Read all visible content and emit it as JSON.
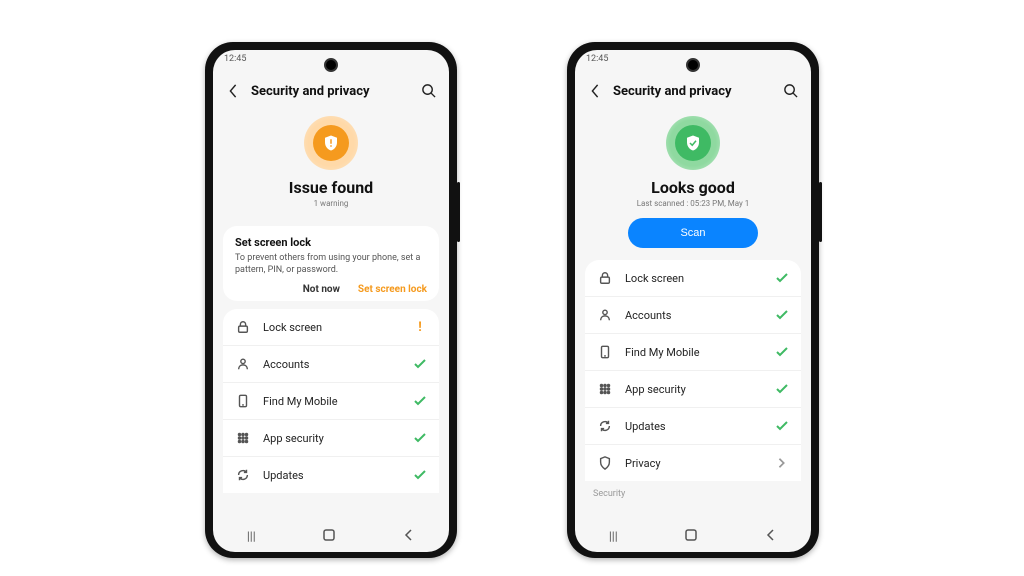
{
  "time": "12:45",
  "header_title": "Security and privacy",
  "left": {
    "status": "warn",
    "heading": "Issue found",
    "sub": "1 warning",
    "card": {
      "title": "Set screen lock",
      "desc": "To prevent others from using your phone, set a pattern, PIN, or password.",
      "ignore": "Not now",
      "primary": "Set screen lock"
    },
    "rows": [
      {
        "icon": "lock",
        "label": "Lock screen",
        "status": "alert"
      },
      {
        "icon": "user",
        "label": "Accounts",
        "status": "ok"
      },
      {
        "icon": "device",
        "label": "Find My Mobile",
        "status": "ok"
      },
      {
        "icon": "grid",
        "label": "App security",
        "status": "ok"
      },
      {
        "icon": "update",
        "label": "Updates",
        "status": "ok"
      }
    ]
  },
  "right": {
    "status": "ok",
    "heading": "Looks good",
    "sub": "Last scanned : 05:23 PM, May 1",
    "scan": "Scan",
    "rows": [
      {
        "icon": "lock",
        "label": "Lock screen",
        "status": "ok"
      },
      {
        "icon": "user",
        "label": "Accounts",
        "status": "ok"
      },
      {
        "icon": "device",
        "label": "Find My Mobile",
        "status": "ok"
      },
      {
        "icon": "grid",
        "label": "App security",
        "status": "ok"
      },
      {
        "icon": "update",
        "label": "Updates",
        "status": "ok"
      },
      {
        "icon": "privacy",
        "label": "Privacy",
        "status": "chev"
      }
    ],
    "section": "Security"
  }
}
